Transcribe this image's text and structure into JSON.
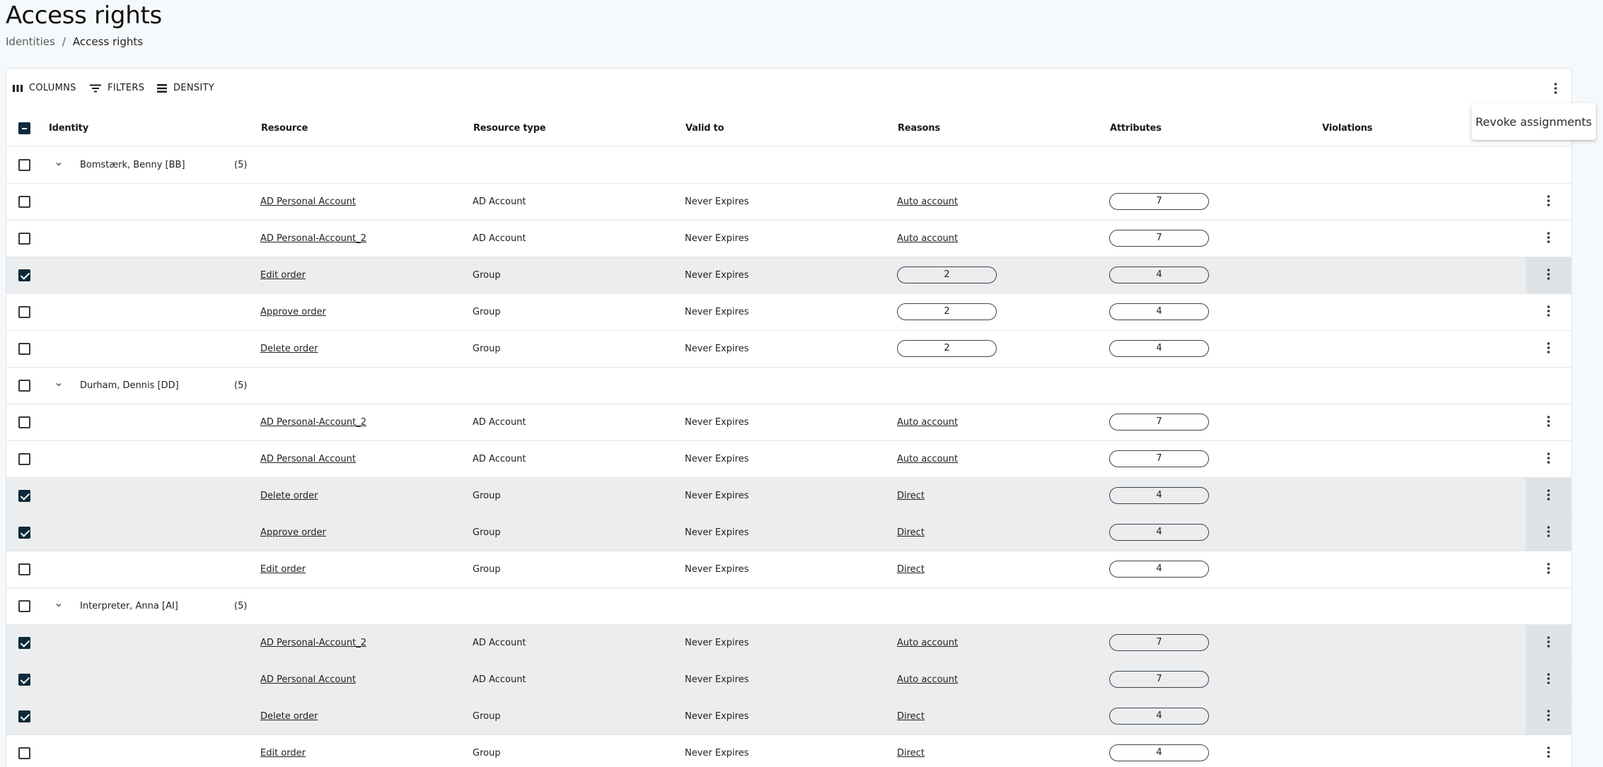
{
  "page": {
    "title": "Access rights"
  },
  "breadcrumb": {
    "parent": "Identities",
    "separator": "/",
    "current": "Access rights"
  },
  "toolbar": {
    "columns": "COLUMNS",
    "filters": "FILTERS",
    "density": "DENSITY"
  },
  "popover": {
    "label": "Revoke assignments"
  },
  "columns": [
    "Identity",
    "Resource",
    "Resource type",
    "Valid to",
    "Reasons",
    "Attributes",
    "Violations"
  ],
  "header_checkbox_state": "indeterminate",
  "rows": [
    {
      "kind": "group",
      "identity": "Bomstærk, Benny [BB]",
      "count": "(5)",
      "checked": false
    },
    {
      "kind": "item",
      "resource": "AD Personal Account",
      "type": "AD Account",
      "valid": "Never Expires",
      "reason": "Auto account",
      "reason_is_pill": false,
      "attributes": "7",
      "checked": false
    },
    {
      "kind": "item",
      "resource": "AD Personal-Account_2",
      "type": "AD Account",
      "valid": "Never Expires",
      "reason": "Auto account",
      "reason_is_pill": false,
      "attributes": "7",
      "checked": false
    },
    {
      "kind": "item",
      "resource": "Edit order",
      "type": "Group",
      "valid": "Never Expires",
      "reason": "2",
      "reason_is_pill": true,
      "attributes": "4",
      "checked": true
    },
    {
      "kind": "item",
      "resource": "Approve order",
      "type": "Group",
      "valid": "Never Expires",
      "reason": "2",
      "reason_is_pill": true,
      "attributes": "4",
      "checked": false
    },
    {
      "kind": "item",
      "resource": "Delete order",
      "type": "Group",
      "valid": "Never Expires",
      "reason": "2",
      "reason_is_pill": true,
      "attributes": "4",
      "checked": false
    },
    {
      "kind": "group",
      "identity": "Durham, Dennis [DD]",
      "count": "(5)",
      "checked": false
    },
    {
      "kind": "item",
      "resource": "AD Personal-Account_2",
      "type": "AD Account",
      "valid": "Never Expires",
      "reason": "Auto account",
      "reason_is_pill": false,
      "attributes": "7",
      "checked": false
    },
    {
      "kind": "item",
      "resource": "AD Personal Account",
      "type": "AD Account",
      "valid": "Never Expires",
      "reason": "Auto account",
      "reason_is_pill": false,
      "attributes": "7",
      "checked": false
    },
    {
      "kind": "item",
      "resource": "Delete order",
      "type": "Group",
      "valid": "Never Expires",
      "reason": "Direct",
      "reason_is_pill": false,
      "attributes": "4",
      "checked": true
    },
    {
      "kind": "item",
      "resource": "Approve order",
      "type": "Group",
      "valid": "Never Expires",
      "reason": "Direct",
      "reason_is_pill": false,
      "attributes": "4",
      "checked": true
    },
    {
      "kind": "item",
      "resource": "Edit order",
      "type": "Group",
      "valid": "Never Expires",
      "reason": "Direct",
      "reason_is_pill": false,
      "attributes": "4",
      "checked": false
    },
    {
      "kind": "group",
      "identity": "Interpreter, Anna [AI]",
      "count": "(5)",
      "checked": false
    },
    {
      "kind": "item",
      "resource": "AD Personal-Account_2",
      "type": "AD Account",
      "valid": "Never Expires",
      "reason": "Auto account",
      "reason_is_pill": false,
      "attributes": "7",
      "checked": true
    },
    {
      "kind": "item",
      "resource": "AD Personal Account",
      "type": "AD Account",
      "valid": "Never Expires",
      "reason": "Auto account",
      "reason_is_pill": false,
      "attributes": "7",
      "checked": true
    },
    {
      "kind": "item",
      "resource": "Delete order",
      "type": "Group",
      "valid": "Never Expires",
      "reason": "Direct",
      "reason_is_pill": false,
      "attributes": "4",
      "checked": true
    },
    {
      "kind": "item",
      "resource": "Edit order",
      "type": "Group",
      "valid": "Never Expires",
      "reason": "Direct",
      "reason_is_pill": false,
      "attributes": "4",
      "checked": false
    }
  ],
  "icons": {
    "columns": "view-columns-icon",
    "filters": "filter-icon",
    "density": "density-icon",
    "more": "more-vertical-icon",
    "expand": "chevron-down-icon"
  },
  "colors": {
    "checkbox_checked": "#0e2a3a",
    "selected_row": "#ebedef",
    "background": "#f6f9fb"
  }
}
